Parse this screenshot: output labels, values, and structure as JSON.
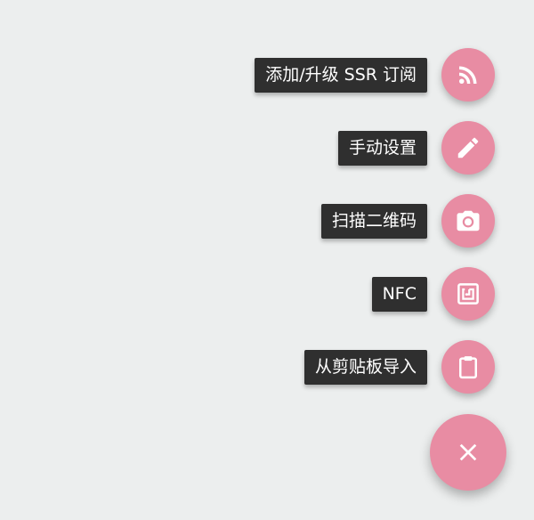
{
  "menu": {
    "items": [
      {
        "label": "添加/升级 SSR 订阅",
        "icon": "rss-feed-icon"
      },
      {
        "label": "手动设置",
        "icon": "pencil-icon"
      },
      {
        "label": "扫描二维码",
        "icon": "camera-icon"
      },
      {
        "label": "NFC",
        "icon": "nfc-icon"
      },
      {
        "label": "从剪贴板导入",
        "icon": "clipboard-icon"
      }
    ],
    "close_icon": "close-icon"
  },
  "colors": {
    "background": "#eceeee",
    "fab": "#e88ca3",
    "label_bg": "#2f2f2f",
    "label_text": "#ffffff",
    "icon": "#ffffff"
  }
}
